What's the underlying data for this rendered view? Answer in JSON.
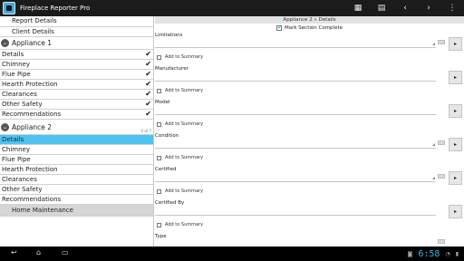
{
  "app": {
    "title": "Fireplace Reporter Pro"
  },
  "actionbar": {
    "icons": [
      "grid-icon",
      "document-icon",
      "back-icon",
      "forward-icon",
      "overflow-menu-icon"
    ]
  },
  "sidebar": {
    "top_items": [
      {
        "label": "Report Details"
      },
      {
        "label": "Client Details"
      }
    ],
    "appliance1": {
      "title": "Appliance 1",
      "items": [
        {
          "label": "Details",
          "checked": true
        },
        {
          "label": "Chimney",
          "checked": true
        },
        {
          "label": "Flue Pipe",
          "checked": true
        },
        {
          "label": "Hearth Protection",
          "checked": true
        },
        {
          "label": "Clearances",
          "checked": true
        },
        {
          "label": "Other Safety",
          "checked": true
        },
        {
          "label": "Recommendations",
          "checked": true
        }
      ]
    },
    "appliance2": {
      "title": "Appliance 2",
      "counter": "0 of 7",
      "items": [
        {
          "label": "Details",
          "selected": true
        },
        {
          "label": "Chimney"
        },
        {
          "label": "Flue Pipe"
        },
        {
          "label": "Hearth Protection"
        },
        {
          "label": "Clearances"
        },
        {
          "label": "Other Safety"
        },
        {
          "label": "Recommendations"
        }
      ]
    },
    "footer_item": {
      "label": "Home Maintenance"
    }
  },
  "main": {
    "breadcrumb": "Appliance 2 » Details",
    "mark_complete": {
      "label": "Mark Section Complete",
      "checked": true
    },
    "add_to_summary_label": "Add to Summary",
    "fields": [
      {
        "label": "Limitations",
        "value": ""
      },
      {
        "label": "Manufacturer",
        "value": ""
      },
      {
        "label": "Model",
        "value": ""
      },
      {
        "label": "Condition",
        "value": ""
      },
      {
        "label": "Certified",
        "value": ""
      },
      {
        "label": "Certified By",
        "value": ""
      },
      {
        "label": "Type",
        "value": ""
      }
    ]
  },
  "navbar": {
    "clock": "6:58",
    "icons": [
      "back-nav-icon",
      "home-nav-icon",
      "recent-apps-icon",
      "camera-icon",
      "wifi-icon",
      "battery-icon"
    ]
  },
  "colors": {
    "accent": "#4fc3ef",
    "clock": "#33b5e5",
    "actionbar": "#1b1b1b"
  }
}
